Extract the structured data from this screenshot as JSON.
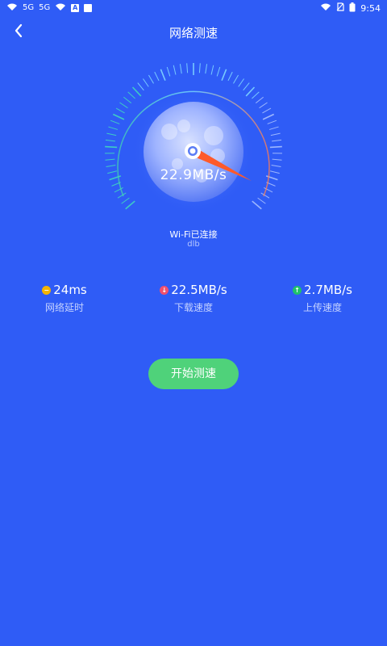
{
  "status_bar": {
    "network_labels": [
      "5G",
      "5G"
    ],
    "time": "9:54"
  },
  "header": {
    "title": "网络测速",
    "back_icon": "chevron-left-icon"
  },
  "gauge": {
    "speed": "22.9MB/s"
  },
  "connection": {
    "status": "Wi-Fi已连接",
    "ssid": "dlb"
  },
  "stats": [
    {
      "value": "24ms",
      "label": "网络延时",
      "icon": "minus-circle-icon",
      "color": "#f4b400"
    },
    {
      "value": "22.5MB/s",
      "label": "下载速度",
      "icon": "arrow-down-circle-icon",
      "color": "#f0506e"
    },
    {
      "value": "2.7MB/s",
      "label": "上传速度",
      "icon": "arrow-up-circle-icon",
      "color": "#20c26a"
    }
  ],
  "actions": {
    "start_label": "开始测速"
  },
  "colors": {
    "background": "#2f5cf6",
    "start_button": "#4fd27a",
    "needle": "#ff5a2a"
  }
}
